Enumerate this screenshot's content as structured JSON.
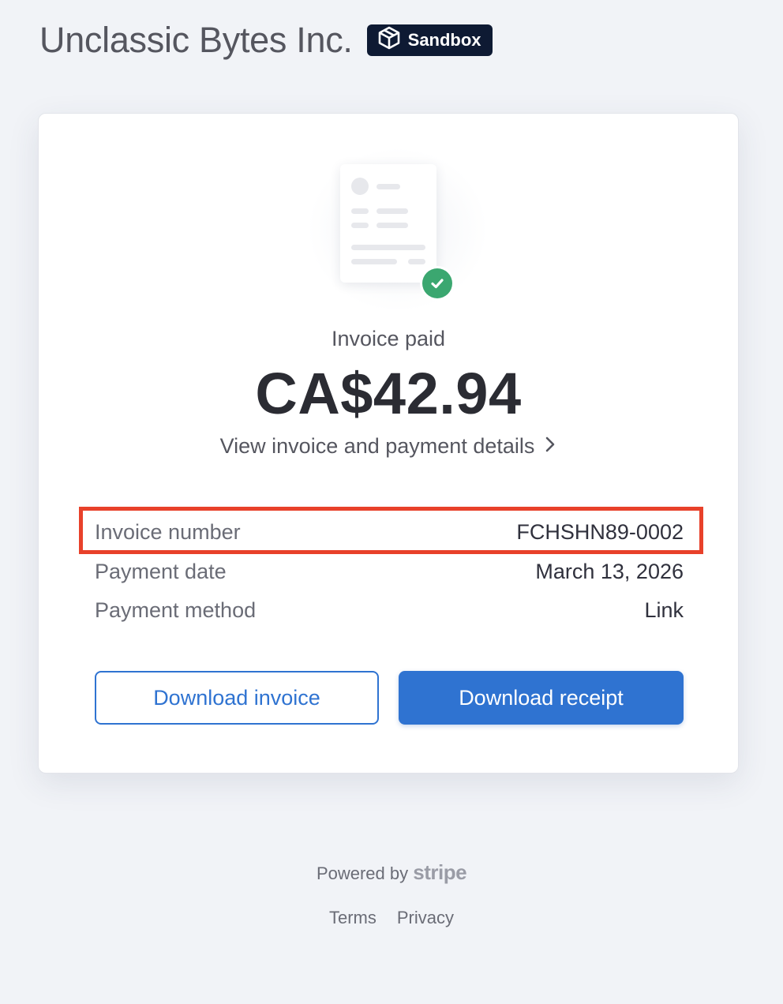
{
  "header": {
    "merchant_name": "Unclassic Bytes Inc.",
    "badge_label": "Sandbox",
    "badge_icon": "sandbox-box-icon"
  },
  "card": {
    "status": "Invoice paid",
    "amount": "CA$42.94",
    "details_link": "View invoice and payment details",
    "details": [
      {
        "label": "Invoice number",
        "value": "FCHSHN89-0002"
      },
      {
        "label": "Payment date",
        "value": "March 13, 2026"
      },
      {
        "label": "Payment method",
        "value": "Link"
      }
    ],
    "download_invoice": "Download invoice",
    "download_receipt": "Download receipt"
  },
  "footer": {
    "powered_by": "Powered by",
    "brand": "stripe",
    "links": [
      "Terms",
      "Privacy"
    ]
  },
  "colors": {
    "accent": "#2f73d1",
    "success": "#3ba770",
    "highlight": "#e8412a",
    "badge_bg": "#0e1a33"
  }
}
